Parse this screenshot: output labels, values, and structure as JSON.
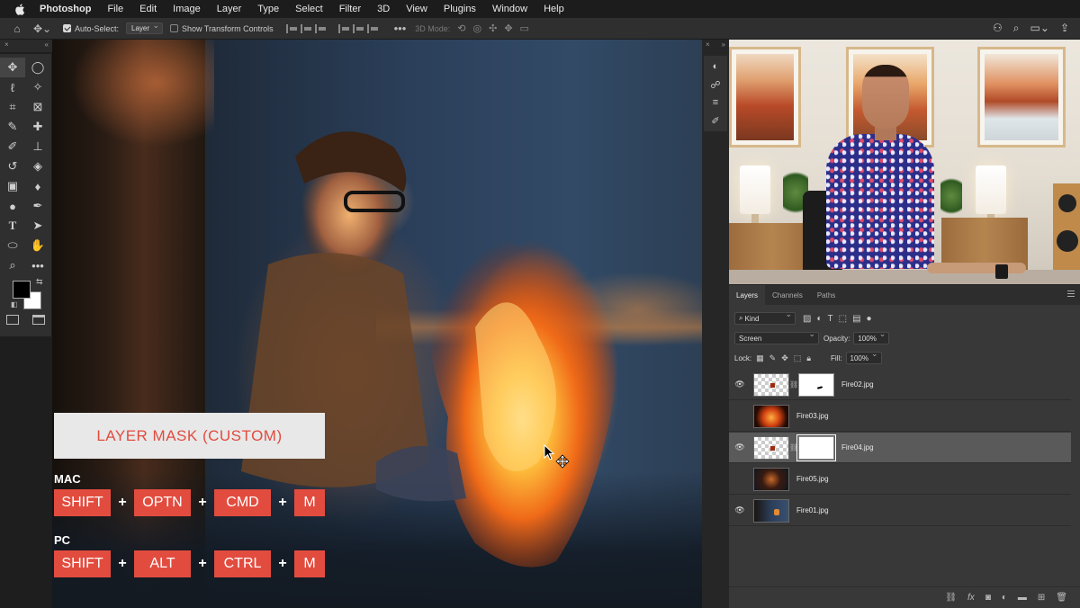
{
  "menubar": {
    "app_name": "Photoshop",
    "items": [
      "File",
      "Edit",
      "Image",
      "Layer",
      "Type",
      "Select",
      "Filter",
      "3D",
      "View",
      "Plugins",
      "Window",
      "Help"
    ]
  },
  "options": {
    "auto_select_label": "Auto-Select:",
    "auto_select_checked": true,
    "auto_select_value": "Layer",
    "transform_label": "Show Transform Controls",
    "mode_3d_label": "3D Mode:"
  },
  "overlay": {
    "title": "LAYER MASK (CUSTOM)",
    "mac_label": "MAC",
    "mac_keys": [
      "SHIFT",
      "OPTN",
      "CMD",
      "M"
    ],
    "pc_label": "PC",
    "pc_keys": [
      "SHIFT",
      "ALT",
      "CTRL",
      "M"
    ],
    "plus": "+",
    "accent_color": "#e24c3f"
  },
  "layers_panel": {
    "tabs": [
      "Layers",
      "Channels",
      "Paths"
    ],
    "active_tab": "Layers",
    "filter_kind": "Kind",
    "blend_mode": "Screen",
    "opacity_label": "Opacity:",
    "opacity_value": "100%",
    "lock_label": "Lock:",
    "fill_label": "Fill:",
    "fill_value": "100%",
    "layers": [
      {
        "name": "Fire02.jpg",
        "visible": true,
        "has_mask": true,
        "selected": false
      },
      {
        "name": "Fire03.jpg",
        "visible": false,
        "has_mask": false,
        "selected": false
      },
      {
        "name": "Fire04.jpg",
        "visible": true,
        "has_mask": true,
        "selected": true
      },
      {
        "name": "Fire05.jpg",
        "visible": false,
        "has_mask": false,
        "selected": false
      },
      {
        "name": "Fire01.jpg",
        "visible": true,
        "has_mask": false,
        "selected": false
      }
    ]
  }
}
